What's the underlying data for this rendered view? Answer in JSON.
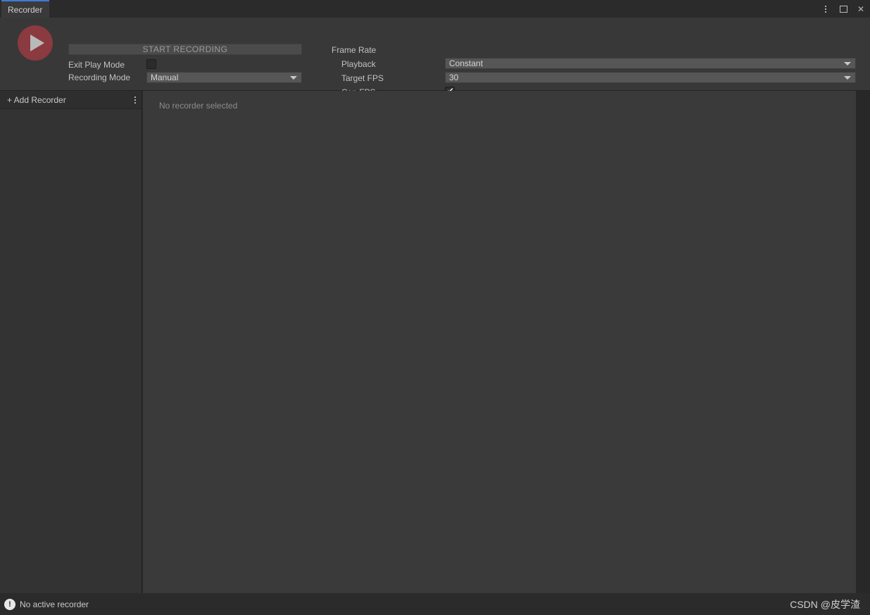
{
  "window": {
    "tab_label": "Recorder",
    "controls": {
      "menu_icon": "kebab-menu-icon",
      "maximize_icon": "maximize-icon",
      "close_icon": "close-icon",
      "close_glyph": "✕"
    },
    "accent_color": "#3f7bd6"
  },
  "header": {
    "play_button_icon": "play-icon",
    "play_button_color": "#8b3a3f",
    "start_recording_label": "START RECORDING",
    "exit_play_mode": {
      "label": "Exit Play Mode",
      "checked": false
    },
    "recording_mode": {
      "label": "Recording Mode",
      "value": "Manual"
    },
    "frame_rate": {
      "section_label": "Frame Rate",
      "playback": {
        "label": "Playback",
        "value": "Constant"
      },
      "target_fps": {
        "label": "Target FPS",
        "value": "30"
      },
      "cap_fps": {
        "label": "Cap FPS",
        "checked": true,
        "check_glyph": "✔"
      }
    }
  },
  "left_panel": {
    "add_recorder_label": "+ Add Recorder",
    "menu_icon": "kebab-menu-icon",
    "items": []
  },
  "right_panel": {
    "empty_message": "No recorder selected"
  },
  "statusbar": {
    "icon": "warning-icon",
    "icon_glyph": "!",
    "message": "No active recorder",
    "watermark": "CSDN @皮学渣"
  }
}
